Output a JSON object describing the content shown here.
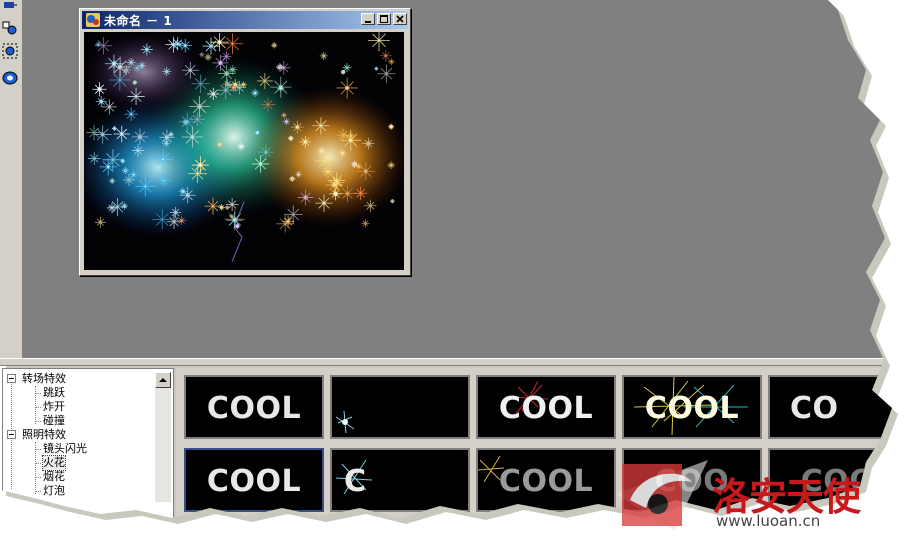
{
  "child_window": {
    "title": "未命名 － 1",
    "buttons": [
      "minimize",
      "maximize",
      "close"
    ]
  },
  "tool_icons": [
    "transform-tool-icon",
    "node-tool-icon",
    "select-node-tool-icon",
    "view-tool-icon"
  ],
  "tree": {
    "items": [
      {
        "label": "转场特效",
        "level": 0,
        "toggle": true
      },
      {
        "label": "跳跃",
        "level": 1
      },
      {
        "label": "炸开",
        "level": 1
      },
      {
        "label": "碰撞",
        "level": 1
      },
      {
        "label": "照明特效",
        "level": 0,
        "toggle": true
      },
      {
        "label": "镜头闪光",
        "level": 1
      },
      {
        "label": "火花",
        "level": 1,
        "selected": true
      },
      {
        "label": "烟花",
        "level": 1
      },
      {
        "label": "灯泡",
        "level": 1
      }
    ]
  },
  "thumbnails": [
    {
      "text": "COOL",
      "effect": "plain"
    },
    {
      "text": "",
      "effect": "spark-corner"
    },
    {
      "text": "COOL",
      "effect": "red-spark"
    },
    {
      "text": "COOL",
      "effect": "gold-fireworks"
    },
    {
      "text": "CO",
      "effect": "sparkle"
    },
    {
      "text": "COOL",
      "effect": "plain-dim",
      "selected": true
    },
    {
      "text": "C",
      "effect": "cyan-spark"
    },
    {
      "text": "COOL",
      "effect": "gold-burst"
    },
    {
      "text": "COO",
      "effect": "dim"
    },
    {
      "text": "COO",
      "effect": "dim"
    }
  ],
  "watermark": {
    "title": "洛安天使",
    "url": "www.luoan.cn"
  },
  "colors": {
    "workspace": "#808080",
    "face": "#d4d0c8",
    "titlebar_start": "#0a246a",
    "titlebar_end": "#a6caf0",
    "watermark_red": "#c8181c"
  }
}
